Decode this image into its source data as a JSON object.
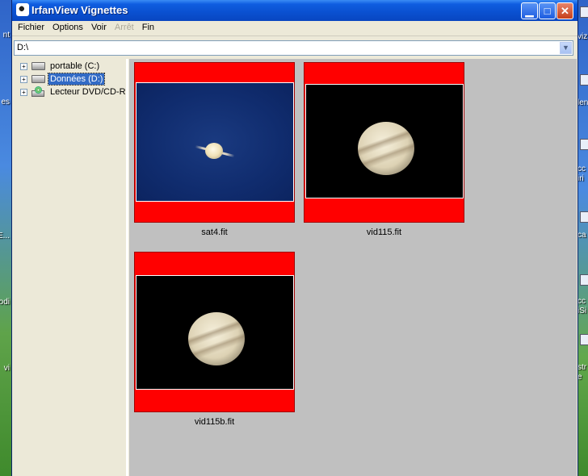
{
  "window": {
    "title": "IrfanView Vignettes"
  },
  "menu": [
    {
      "label": "Fichier",
      "enabled": true
    },
    {
      "label": "Options",
      "enabled": true
    },
    {
      "label": "Voir",
      "enabled": true
    },
    {
      "label": "Arrêt",
      "enabled": false
    },
    {
      "label": "Fin",
      "enabled": true
    }
  ],
  "path": {
    "value": "D:\\"
  },
  "tree": {
    "items": [
      {
        "label": "portable (C:)",
        "icon": "hard-drive-icon",
        "selected": false
      },
      {
        "label": "Données (D:)",
        "icon": "hard-drive-icon",
        "selected": true
      },
      {
        "label": "Lecteur DVD/CD-RW",
        "icon": "dvd-drive-icon",
        "selected": false
      }
    ]
  },
  "thumbnails": [
    {
      "filename": "sat4.fit",
      "subject": "saturn"
    },
    {
      "filename": "vid115.fit",
      "subject": "jupiter"
    },
    {
      "filename": "vid115b.fit",
      "subject": "jupiter"
    }
  ],
  "desktop": {
    "left_labels": [
      "nt",
      "es",
      "E...",
      "odi",
      "vi"
    ],
    "right_labels": [
      "viz",
      "len",
      "cc",
      "iri",
      "ca",
      "cc",
      "iSi",
      "str",
      "e"
    ]
  },
  "colors": {
    "thumbnail_frame": "#ff0000",
    "thumbnail_panel": "#c0c0c0",
    "titlebar": "#0a50d0",
    "selection": "#316ac5"
  }
}
